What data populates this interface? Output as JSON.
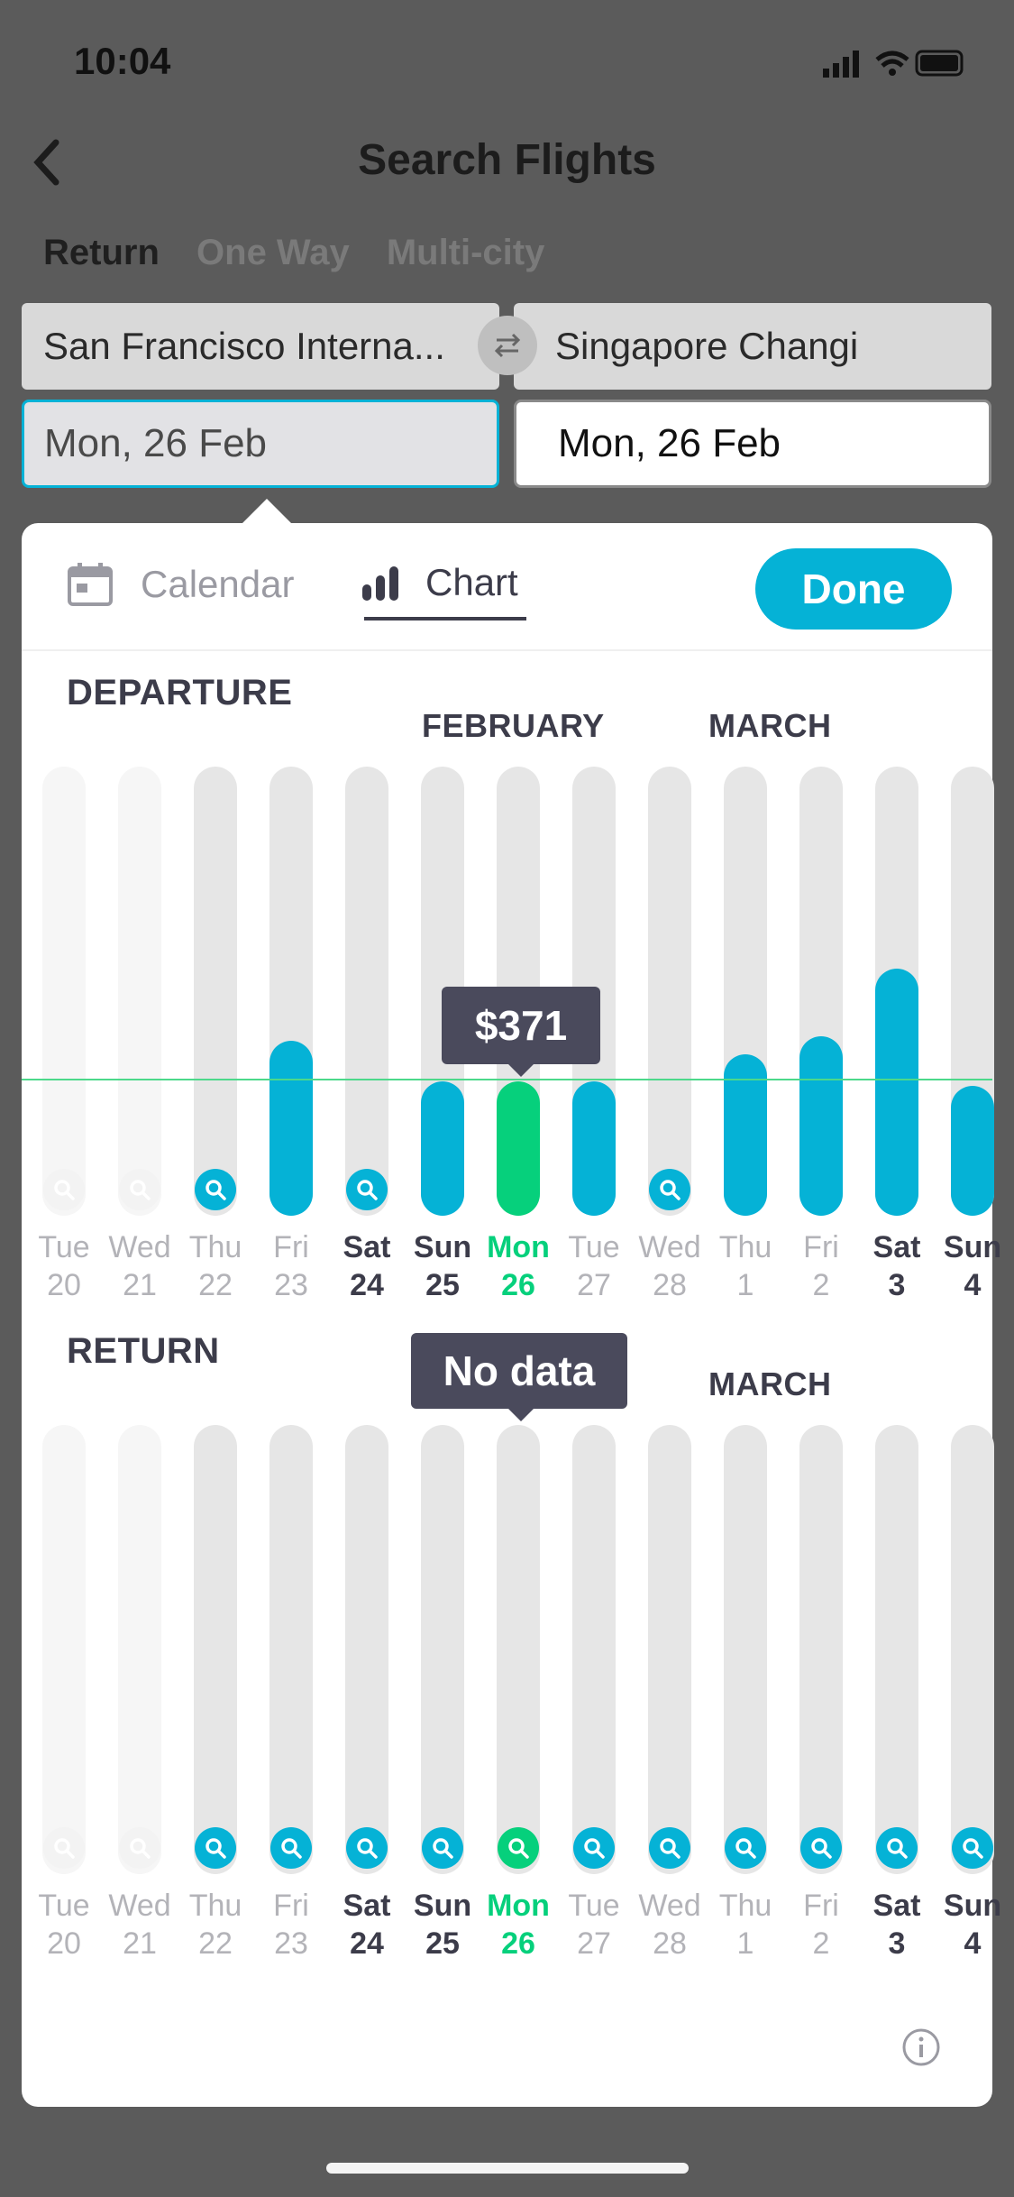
{
  "status": {
    "time": "10:04"
  },
  "header": {
    "title": "Search Flights"
  },
  "trip_tabs": [
    {
      "label": "Return",
      "active": true
    },
    {
      "label": "One Way",
      "active": false
    },
    {
      "label": "Multi-city",
      "active": false
    }
  ],
  "route": {
    "from": "San Francisco Interna...",
    "to": "Singapore Changi"
  },
  "dates": {
    "depart": "Mon, 26 Feb",
    "return": "Mon, 26 Feb"
  },
  "popover": {
    "calendar_label": "Calendar",
    "chart_label": "Chart",
    "done_label": "Done"
  },
  "departure": {
    "label": "DEPARTURE",
    "month_feb": "FEBRUARY",
    "month_mar": "MARCH",
    "tooltip": "$371"
  },
  "return_section": {
    "label": "RETURN",
    "month_mar": "MARCH",
    "tooltip": "No data"
  },
  "colors": {
    "accent": "#05b2d6",
    "selected": "#06d07c",
    "tooltip": "#4a4a5c"
  },
  "days": [
    {
      "dow": "Tue",
      "day": "20",
      "style": "faint"
    },
    {
      "dow": "Wed",
      "day": "21",
      "style": "faint"
    },
    {
      "dow": "Thu",
      "day": "22",
      "style": "normal"
    },
    {
      "dow": "Fri",
      "day": "23",
      "style": "normal"
    },
    {
      "dow": "Sat",
      "day": "24",
      "style": "bold"
    },
    {
      "dow": "Sun",
      "day": "25",
      "style": "bold"
    },
    {
      "dow": "Mon",
      "day": "26",
      "style": "selected"
    },
    {
      "dow": "Tue",
      "day": "27",
      "style": "normal"
    },
    {
      "dow": "Wed",
      "day": "28",
      "style": "normal"
    },
    {
      "dow": "Thu",
      "day": "1",
      "style": "normal"
    },
    {
      "dow": "Fri",
      "day": "2",
      "style": "normal"
    },
    {
      "dow": "Sat",
      "day": "3",
      "style": "bold"
    },
    {
      "dow": "Sun",
      "day": "4",
      "style": "bold"
    }
  ],
  "chart_data": [
    {
      "type": "bar",
      "section": "DEPARTURE",
      "categories": [
        "Tue 20",
        "Wed 21",
        "Thu 22",
        "Fri 23",
        "Sat 24",
        "Sun 25",
        "Mon 26",
        "Tue 27",
        "Wed 28",
        "Thu 1",
        "Fri 2",
        "Sat 3",
        "Sun 4"
      ],
      "values": [
        null,
        null,
        null,
        0.39,
        null,
        0.3,
        0.3,
        0.3,
        null,
        0.36,
        0.4,
        0.55,
        0.29
      ],
      "search_prompt": [
        true,
        true,
        true,
        false,
        true,
        false,
        false,
        false,
        true,
        false,
        false,
        false,
        false
      ],
      "selected_index": 6,
      "selected_label": "$371"
    },
    {
      "type": "bar",
      "section": "RETURN",
      "categories": [
        "Tue 20",
        "Wed 21",
        "Thu 22",
        "Fri 23",
        "Sat 24",
        "Sun 25",
        "Mon 26",
        "Tue 27",
        "Wed 28",
        "Thu 1",
        "Fri 2",
        "Sat 3",
        "Sun 4"
      ],
      "values": [
        null,
        null,
        null,
        null,
        null,
        null,
        null,
        null,
        null,
        null,
        null,
        null,
        null
      ],
      "search_prompt": [
        true,
        true,
        true,
        true,
        true,
        true,
        true,
        true,
        true,
        true,
        true,
        true,
        true
      ],
      "selected_index": 6,
      "selected_label": "No data"
    }
  ]
}
